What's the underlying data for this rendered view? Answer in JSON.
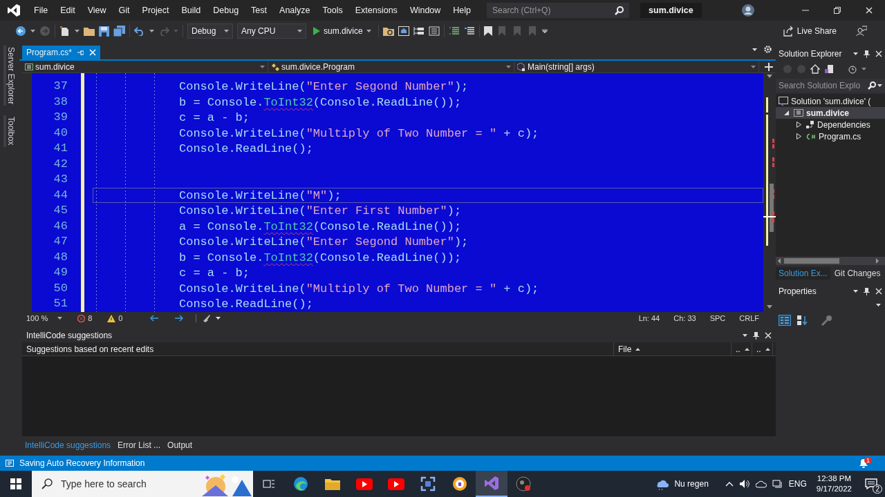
{
  "window": {
    "title": "sum.divice",
    "menu": [
      "File",
      "Edit",
      "View",
      "Git",
      "Project",
      "Build",
      "Debug",
      "Test",
      "Analyze",
      "Tools",
      "Extensions",
      "Window",
      "Help"
    ],
    "search": {
      "placeholder": "Search (Ctrl+Q)"
    }
  },
  "toolbar": {
    "configuration": "Debug",
    "platform": "Any CPU",
    "start": "sum.divice",
    "live_share": "Live Share"
  },
  "side_tabs": [
    "Server Explorer",
    "Toolbox"
  ],
  "document_tabs": [
    {
      "label": "Program.cs*",
      "selected": true
    }
  ],
  "nav_bar": [
    "sum.divice",
    "sum.divice.Program",
    "Main(string[] args)"
  ],
  "code_lines": [
    {
      "number": "37",
      "current": false,
      "tokens": [
        {
          "kind": "plain",
          "text": "Console.WriteLine("
        },
        {
          "kind": "string",
          "text": "\"Enter Segond Number\""
        },
        {
          "kind": "plain",
          "text": ");"
        }
      ]
    },
    {
      "number": "38",
      "current": false,
      "tokens": [
        {
          "kind": "plain",
          "text": "b = Console."
        },
        {
          "kind": "error",
          "text": "ToInt32"
        },
        {
          "kind": "plain",
          "text": "(Console.ReadLine());"
        }
      ]
    },
    {
      "number": "39",
      "current": false,
      "tokens": [
        {
          "kind": "plain",
          "text": "c = a - b;"
        }
      ]
    },
    {
      "number": "40",
      "current": false,
      "tokens": [
        {
          "kind": "plain",
          "text": "Console.WriteLine("
        },
        {
          "kind": "string",
          "text": "\"Multiply of Two Number = \""
        },
        {
          "kind": "plain",
          "text": " + c);"
        }
      ]
    },
    {
      "number": "41",
      "current": false,
      "tokens": [
        {
          "kind": "plain",
          "text": "Console.ReadLine();"
        }
      ]
    },
    {
      "number": "42",
      "current": false
    },
    {
      "number": "43",
      "current": false
    },
    {
      "number": "44",
      "current": true,
      "tokens": [
        {
          "kind": "plain",
          "text": "Console.WriteLine("
        },
        {
          "kind": "string",
          "text": "\"M\""
        },
        {
          "kind": "plain",
          "text": ");"
        }
      ]
    },
    {
      "number": "45",
      "current": false,
      "tokens": [
        {
          "kind": "plain",
          "text": "Console.WriteLine("
        },
        {
          "kind": "string",
          "text": "\"Enter First Number\""
        },
        {
          "kind": "plain",
          "text": ");"
        }
      ]
    },
    {
      "number": "46",
      "current": false,
      "tokens": [
        {
          "kind": "plain",
          "text": "a = Console."
        },
        {
          "kind": "error",
          "text": "ToInt32"
        },
        {
          "kind": "plain",
          "text": "(Console.ReadLine());"
        }
      ]
    },
    {
      "number": "47",
      "current": false,
      "tokens": [
        {
          "kind": "plain",
          "text": "Console.WriteLine("
        },
        {
          "kind": "string",
          "text": "\"Enter Segond Number\""
        },
        {
          "kind": "plain",
          "text": ");"
        }
      ]
    },
    {
      "number": "48",
      "current": false,
      "tokens": [
        {
          "kind": "plain",
          "text": "b = Console."
        },
        {
          "kind": "error",
          "text": "ToInt32"
        },
        {
          "kind": "plain",
          "text": "(Console.ReadLine());"
        }
      ]
    },
    {
      "number": "49",
      "current": false,
      "tokens": [
        {
          "kind": "plain",
          "text": "c = a - b;"
        }
      ]
    },
    {
      "number": "50",
      "current": false,
      "tokens": [
        {
          "kind": "plain",
          "text": "Console.WriteLine("
        },
        {
          "kind": "string",
          "text": "\"Multiply of Two Number = \""
        },
        {
          "kind": "plain",
          "text": " + c);"
        }
      ]
    },
    {
      "number": "51",
      "current": false,
      "tokens": [
        {
          "kind": "plain",
          "text": "Console.ReadLine();"
        }
      ]
    }
  ],
  "editor_status": {
    "zoom": "100 %",
    "errors": "8",
    "warnings": "0",
    "position": [
      "Ln: 44",
      "Ch: 33",
      "SPC",
      "CRLF"
    ]
  },
  "intellicode": {
    "title": "IntelliCode suggestions",
    "columns": [
      "Suggestions based on recent edits",
      "File",
      "..",
      ".."
    ]
  },
  "bottom_tabs": [
    {
      "label": "IntelliCode suggestions",
      "selected": true
    },
    {
      "label": "Error List ...",
      "selected": false
    },
    {
      "label": "Output",
      "selected": false
    }
  ],
  "solution_explorer": {
    "title": "Solution Explorer",
    "search": {
      "placeholder": "Search Solution Explo"
    },
    "tree": [
      {
        "label": "Solution 'sum.divice' (",
        "kind": "solution",
        "selected": false,
        "children": [
          {
            "label": "sum.divice",
            "kind": "project",
            "expanded": true,
            "selected": true,
            "children": [
              {
                "label": "Dependencies",
                "kind": "dependencies",
                "expanded": false,
                "selected": false
              },
              {
                "label": "Program.cs",
                "kind": "csharp",
                "expanded": false,
                "selected": false
              }
            ]
          }
        ]
      }
    ],
    "tabs": [
      {
        "label": "Solution Ex...",
        "selected": true
      },
      {
        "label": "Git Changes",
        "selected": false
      }
    ]
  },
  "properties": {
    "title": "Properties"
  },
  "status_bar": {
    "message": "Saving Auto Recovery Information",
    "notifications": "1"
  },
  "taskbar": {
    "search": {
      "placeholder": "Type here to search"
    },
    "weather": "Nu regen",
    "language": "ENG",
    "time": "12:38 PM",
    "date": "9/17/2022",
    "notifications": "2"
  }
}
